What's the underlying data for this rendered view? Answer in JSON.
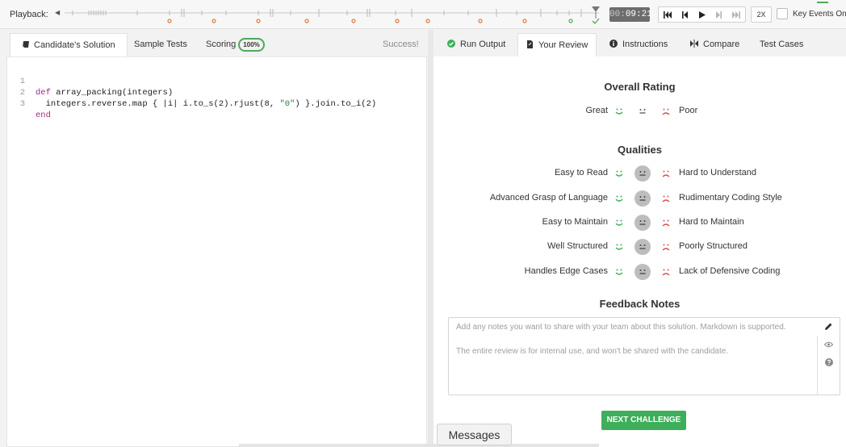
{
  "playback": {
    "label": "Playback:",
    "time_dim": "00:",
    "time_main": "09:21",
    "speed": "2X",
    "key_events_label": "Key Events Only",
    "controls": [
      "skip-start-icon",
      "step-back-icon",
      "play-icon",
      "step-forward-icon",
      "skip-end-icon"
    ]
  },
  "left_tabs": {
    "solution": "Candidate's Solution",
    "sample_tests": "Sample Tests",
    "scoring": "Scoring",
    "scoring_badge": "100%",
    "status": "Success!"
  },
  "code": {
    "lines": [
      {
        "n": "1",
        "text": "def array_packing(integers)"
      },
      {
        "n": "2",
        "text": "  integers.reverse.map { |i| i.to_s(2).rjust(8, \"0\") }.join.to_i(2)"
      },
      {
        "n": "3",
        "text": "end"
      }
    ]
  },
  "right_tabs": {
    "run_output": "Run Output",
    "your_review": "Your Review",
    "instructions": "Instructions",
    "compare": "Compare",
    "test_cases": "Test Cases"
  },
  "review": {
    "overall_title": "Overall Rating",
    "overall": {
      "left": "Great",
      "right": "Poor"
    },
    "qualities_title": "Qualities",
    "qualities": [
      {
        "left": "Easy to Read",
        "right": "Hard to Understand"
      },
      {
        "left": "Advanced Grasp of Language",
        "right": "Rudimentary Coding Style"
      },
      {
        "left": "Easy to Maintain",
        "right": "Hard to Maintain"
      },
      {
        "left": "Well Structured",
        "right": "Poorly Structured"
      },
      {
        "left": "Handles Edge Cases",
        "right": "Lack of Defensive Coding"
      }
    ],
    "notes_title": "Feedback Notes",
    "notes_placeholder": "Add any notes you want to share with your team about this solution. Markdown is supported.",
    "notes_hint": "The entire review is for internal use, and won't be shared with the candidate.",
    "next_button": "NEXT CHALLENGE"
  },
  "messages": "Messages",
  "colors": {
    "accent_green": "#3eae5b",
    "sad_red": "#d9534f",
    "timeline_orange": "#e07a3a"
  }
}
